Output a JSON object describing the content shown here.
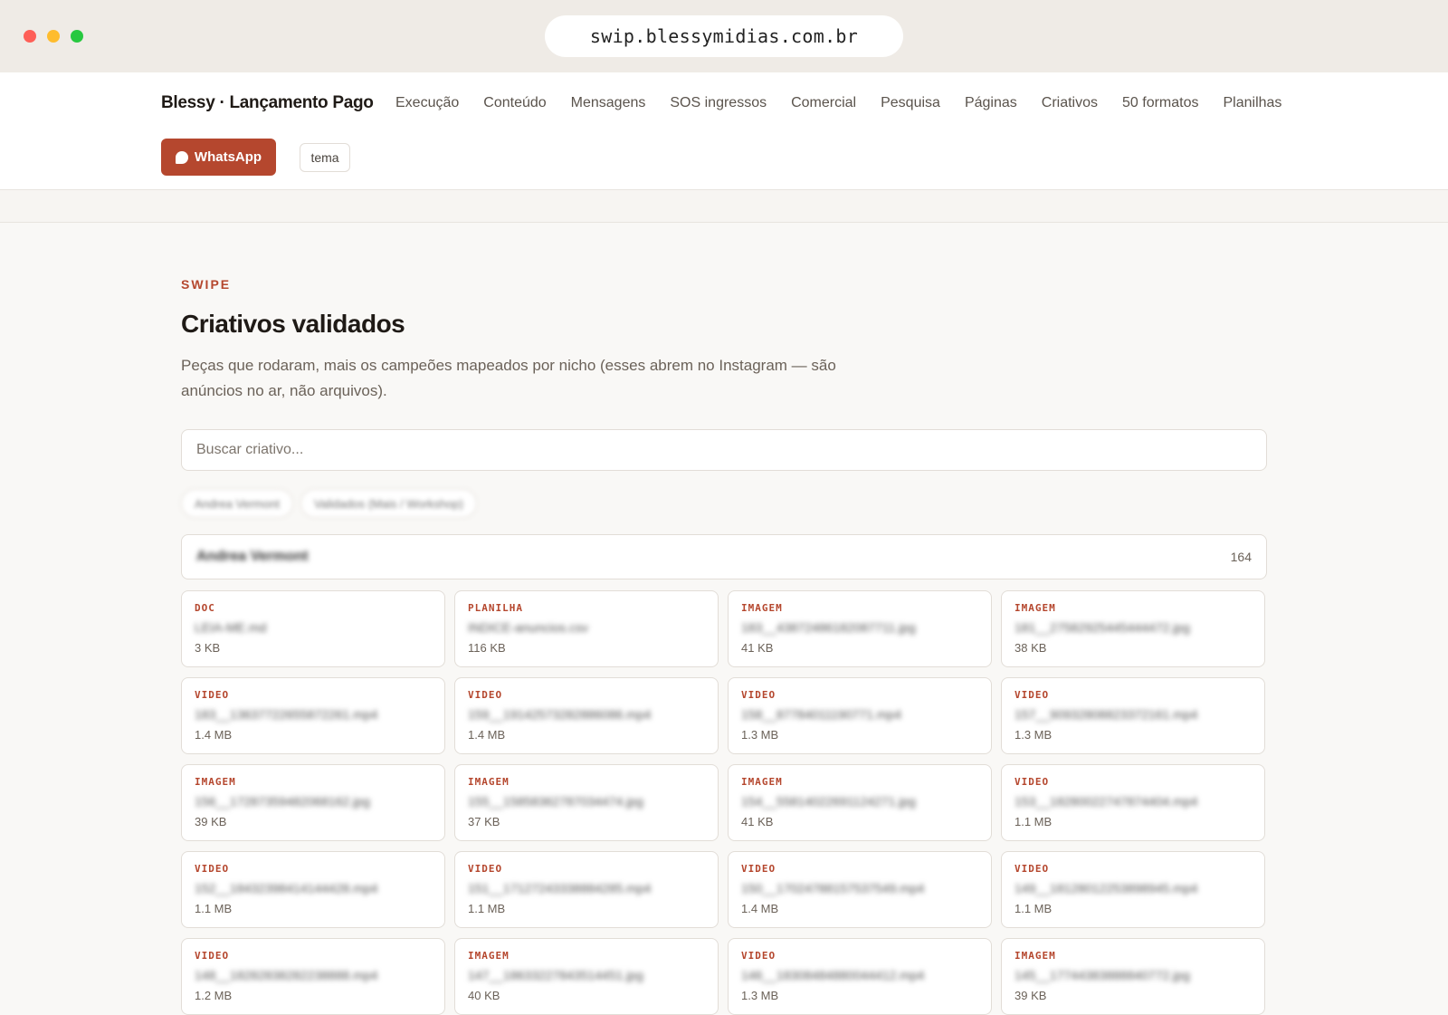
{
  "browser": {
    "url": "swip.blessymidias.com.br",
    "dot_colors": [
      "#fe5f57",
      "#febc2e",
      "#28c840"
    ]
  },
  "nav": {
    "brand": "Blessy · Lançamento Pago",
    "links": [
      "Execução",
      "Conteúdo",
      "Mensagens",
      "SOS ingressos",
      "Comercial",
      "Pesquisa",
      "Páginas",
      "Criativos",
      "50 formatos",
      "Planilhas"
    ],
    "whatsapp_label": "WhatsApp",
    "theme_label": "tema"
  },
  "hero": {
    "eyebrow": "SWIPE",
    "title": "Criativos validados",
    "description": "Peças que rodaram, mais os campeões mapeados por nicho (esses abrem no Instagram — são anúncios no ar, não arquivos)."
  },
  "search": {
    "placeholder": "Buscar criativo..."
  },
  "filters": [
    "Andrea Vermont",
    "Validados (Mais / Workshop)"
  ],
  "group": {
    "name": "Andrea Vermont",
    "count": "164"
  },
  "items": [
    {
      "type": "DOC",
      "name": "LEIA-ME.md",
      "size": "3 KB"
    },
    {
      "type": "PLANILHA",
      "name": "INDICE-anuncios.csv",
      "size": "116 KB"
    },
    {
      "type": "IMAGEM",
      "name": "183__43872486182087711.jpg",
      "size": "41 KB"
    },
    {
      "type": "IMAGEM",
      "name": "181__27582925445444472.jpg",
      "size": "38 KB"
    },
    {
      "type": "VIDEO",
      "name": "183__13637722655872261.mp4",
      "size": "1.4 MB"
    },
    {
      "type": "VIDEO",
      "name": "159__19142573282886086.mp4",
      "size": "1.4 MB"
    },
    {
      "type": "VIDEO",
      "name": "158__87784011190771.mp4",
      "size": "1.3 MB"
    },
    {
      "type": "VIDEO",
      "name": "157__90932808823372161.mp4",
      "size": "1.3 MB"
    },
    {
      "type": "IMAGEM",
      "name": "156__17287359482068162.jpg",
      "size": "39 KB"
    },
    {
      "type": "IMAGEM",
      "name": "155__15858362787034474.jpg",
      "size": "37 KB"
    },
    {
      "type": "IMAGEM",
      "name": "154__55814022691124271.jpg",
      "size": "41 KB"
    },
    {
      "type": "VIDEO",
      "name": "153__18280022747874404.mp4",
      "size": "1.1 MB"
    },
    {
      "type": "VIDEO",
      "name": "152__18432398414144428.mp4",
      "size": "1.1 MB"
    },
    {
      "type": "VIDEO",
      "name": "151__17127243338884285.mp4",
      "size": "1.1 MB"
    },
    {
      "type": "VIDEO",
      "name": "150__17024788157537549.mp4",
      "size": "1.4 MB"
    },
    {
      "type": "VIDEO",
      "name": "149__18128012253898945.mp4",
      "size": "1.1 MB"
    },
    {
      "type": "VIDEO",
      "name": "148__18282838282238888.mp4",
      "size": "1.2 MB"
    },
    {
      "type": "IMAGEM",
      "name": "147__18633227843514451.jpg",
      "size": "40 KB"
    },
    {
      "type": "VIDEO",
      "name": "146__18308484880044412.mp4",
      "size": "1.3 MB"
    },
    {
      "type": "IMAGEM",
      "name": "145__17744383888840772.jpg",
      "size": "39 KB"
    }
  ]
}
